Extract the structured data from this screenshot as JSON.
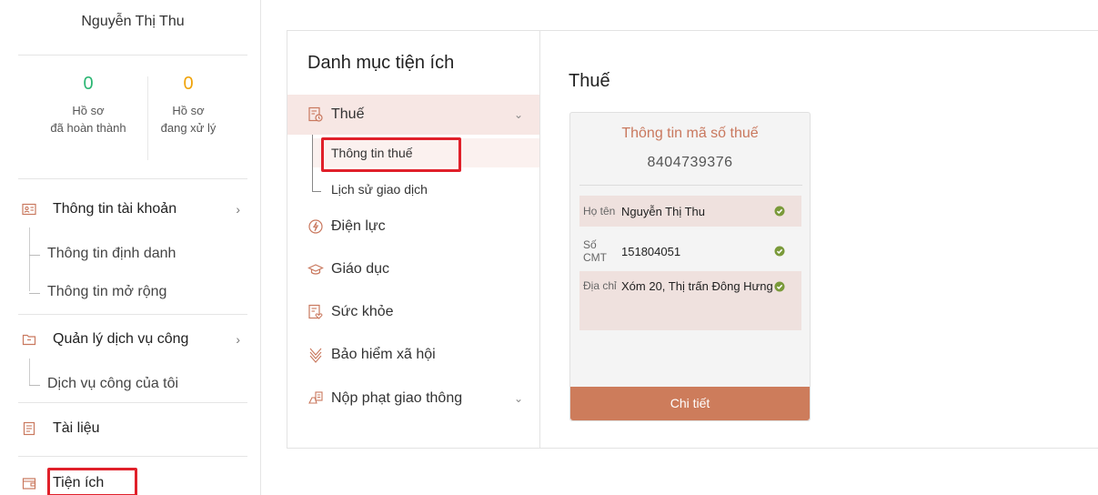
{
  "user": {
    "name": "Nguyễn Thị Thu"
  },
  "stats": [
    {
      "value": "0",
      "label_line1": "Hồ sơ",
      "label_line2": "đã hoàn thành",
      "color": "#2bb673"
    },
    {
      "value": "0",
      "label_line1": "Hồ sơ",
      "label_line2": "đang xử lý",
      "color": "#f0a30a"
    }
  ],
  "sidebar": {
    "account": {
      "label": "Thông tin tài khoản",
      "icon": "id-card-icon",
      "chevron": "›"
    },
    "account_items": [
      "Thông tin định danh",
      "Thông tin mở rộng"
    ],
    "services": {
      "label": "Quản lý dịch vụ công",
      "icon": "folder-icon",
      "chevron": "›"
    },
    "services_items": [
      "Dịch vụ công của tôi"
    ],
    "documents": {
      "label": "Tài liệu",
      "icon": "document-icon"
    },
    "utilities": {
      "label": "Tiện ích",
      "icon": "wallet-icon"
    }
  },
  "categories": {
    "title": "Danh mục tiện ích",
    "items": [
      {
        "label": "Thuế",
        "icon": "tax-icon",
        "expanded": true
      },
      {
        "label": "Điện lực",
        "icon": "electricity-icon"
      },
      {
        "label": "Giáo dục",
        "icon": "graduation-cap-icon"
      },
      {
        "label": "Sức khỏe",
        "icon": "health-record-icon"
      },
      {
        "label": "Bảo hiểm xã hội",
        "icon": "social-insurance-icon"
      },
      {
        "label": "Nộp phạt giao thông",
        "icon": "traffic-fine-icon",
        "expandable": true
      }
    ],
    "tax_sub": [
      "Thông tin thuế",
      "Lịch sử giao dịch"
    ]
  },
  "panel": {
    "title": "Thuế",
    "card": {
      "title": "Thông tin mã số thuế",
      "code": "8404739376",
      "rows": [
        {
          "key": "Họ tên",
          "value": "Nguyễn Thị Thu"
        },
        {
          "key": "Số CMT",
          "value": "151804051"
        },
        {
          "key": "Địa chỉ",
          "value": "Xóm 20, Thị trấn Đông Hưng"
        }
      ],
      "button": "Chi tiết"
    }
  },
  "colors": {
    "accent": "#cd7c5b",
    "highlight": "#e0202a",
    "check": "#7a9a3a"
  }
}
